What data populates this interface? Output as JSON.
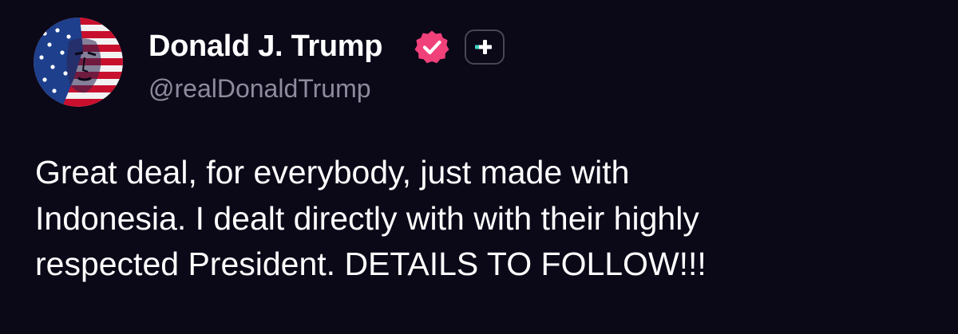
{
  "post": {
    "author": {
      "display_name": "Donald J. Trump",
      "handle": "@realDonaldTrump",
      "avatar_icon": "flag-portrait-avatar",
      "verified_icon": "verified-badge-icon",
      "verified_color": "#f0417a",
      "plus_icon": "plus-icon",
      "plus_color": "#41d3c4"
    },
    "text": "Great deal, for everybody, just made with\nIndonesia. I dealt directly with with their highly\nrespected President. DETAILS TO FOLLOW!!!"
  },
  "colors": {
    "background": "#0b0818",
    "text": "#ffffff",
    "handle": "#8f8b9e"
  }
}
